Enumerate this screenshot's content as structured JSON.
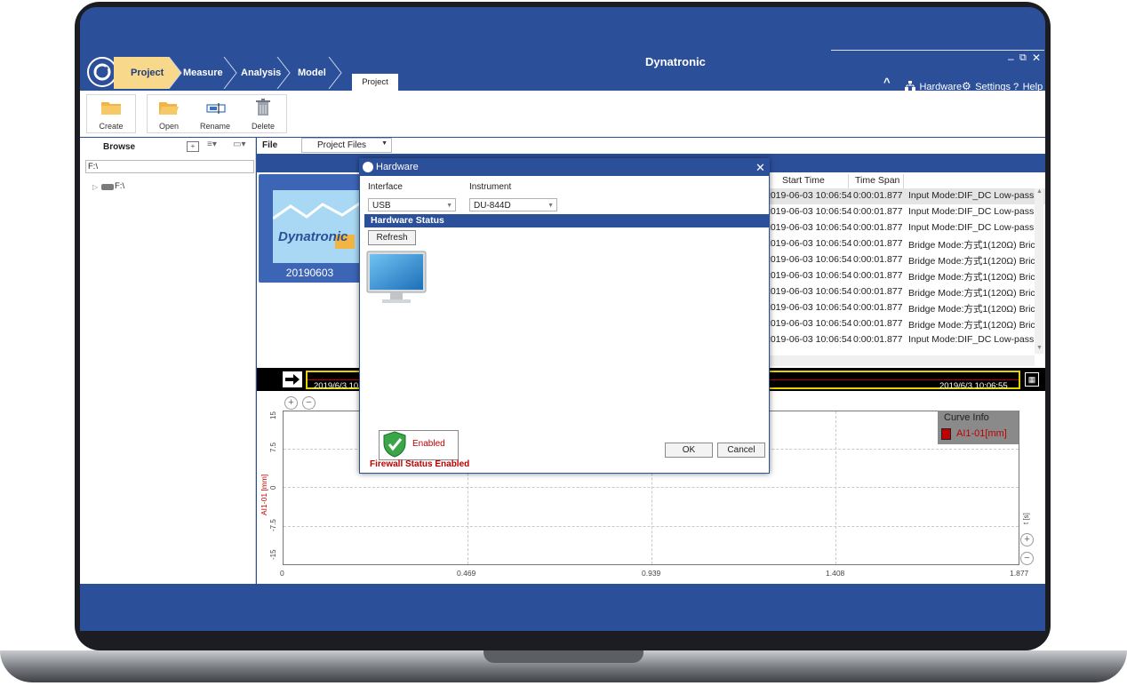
{
  "app": {
    "title": "Dynatronic",
    "window_controls": {
      "minimize": "–",
      "restore": "⧉",
      "close": "✕"
    },
    "top_links": {
      "collapse": "^",
      "hardware": "Hardware",
      "settings": "Settings",
      "help": "Help"
    }
  },
  "nav": {
    "items": [
      {
        "label": "Project",
        "active": true
      },
      {
        "label": "Measure",
        "active": false
      },
      {
        "label": "Analysis",
        "active": false
      },
      {
        "label": "Model",
        "active": false
      }
    ],
    "ribbon_tab": "Project"
  },
  "toolbar": {
    "create": "Create",
    "open": "Open",
    "rename": "Rename",
    "delete": "Delete"
  },
  "browse": {
    "title": "Browse",
    "path": "F:\\",
    "tree_root": "F:\\"
  },
  "file_bar": {
    "label": "File",
    "dropdown": "Project Files"
  },
  "project_tile": {
    "logo": "Dynatronic",
    "name": "20190603"
  },
  "table": {
    "headers": [
      "Start Time",
      "Time Span"
    ],
    "rows": [
      {
        "start": "2019-06-03 10:06:54",
        "span": "0:00:01.877",
        "desc": "Input Mode:DIF_DC Low-pass"
      },
      {
        "start": "2019-06-03 10:06:54",
        "span": "0:00:01.877",
        "desc": "Input Mode:DIF_DC Low-pass"
      },
      {
        "start": "2019-06-03 10:06:54",
        "span": "0:00:01.877",
        "desc": "Input Mode:DIF_DC Low-pass"
      },
      {
        "start": "2019-06-03 10:06:54",
        "span": "0:00:01.877",
        "desc": "Bridge Mode:方式1(120Ω) Bric"
      },
      {
        "start": "2019-06-03 10:06:54",
        "span": "0:00:01.877",
        "desc": "Bridge Mode:方式1(120Ω) Bric"
      },
      {
        "start": "2019-06-03 10:06:54",
        "span": "0:00:01.877",
        "desc": "Bridge Mode:方式1(120Ω) Bric"
      },
      {
        "start": "2019-06-03 10:06:54",
        "span": "0:00:01.877",
        "desc": "Bridge Mode:方式1(120Ω) Bric"
      },
      {
        "start": "2019-06-03 10:06:54",
        "span": "0:00:01.877",
        "desc": "Bridge Mode:方式1(120Ω) Bric"
      },
      {
        "start": "2019-06-03 10:06:54",
        "span": "0:00:01.877",
        "desc": "Bridge Mode:方式1(120Ω) Bric"
      },
      {
        "start": "2019-06-03 10:06:54",
        "span": "0:00:01.877",
        "desc": "Input Mode:DIF_DC Low-pass"
      }
    ]
  },
  "timeline": {
    "start": "2019/6/3 10",
    "end": "2019/6/3 10:06:55"
  },
  "plot": {
    "ylabel": "AI1-01 [mm]",
    "xlabel": "t [s]",
    "y_ticks": [
      "15",
      "7.5",
      "0",
      "-7.5",
      "-15"
    ],
    "x_ticks": [
      "0",
      "0.469",
      "0.939",
      "1.408",
      "1.877"
    ],
    "curve_info_title": "Curve Info",
    "curve_name": "AI1-01[mm]",
    "curve_color": "#c00000"
  },
  "dialog": {
    "title": "Hardware",
    "interface_label": "Interface",
    "interface_value": "USB",
    "instrument_label": "Instrument",
    "instrument_value": "DU-844D",
    "status_header": "Hardware Status",
    "refresh": "Refresh",
    "firewall_badge": "Enabled",
    "firewall_status": "Firewall Status Enabled",
    "ok": "OK",
    "cancel": "Cancel"
  },
  "colors": {
    "brand_blue": "#2c4f9a",
    "crumb_active": "#f8d88b",
    "alert_red": "#c00000"
  }
}
